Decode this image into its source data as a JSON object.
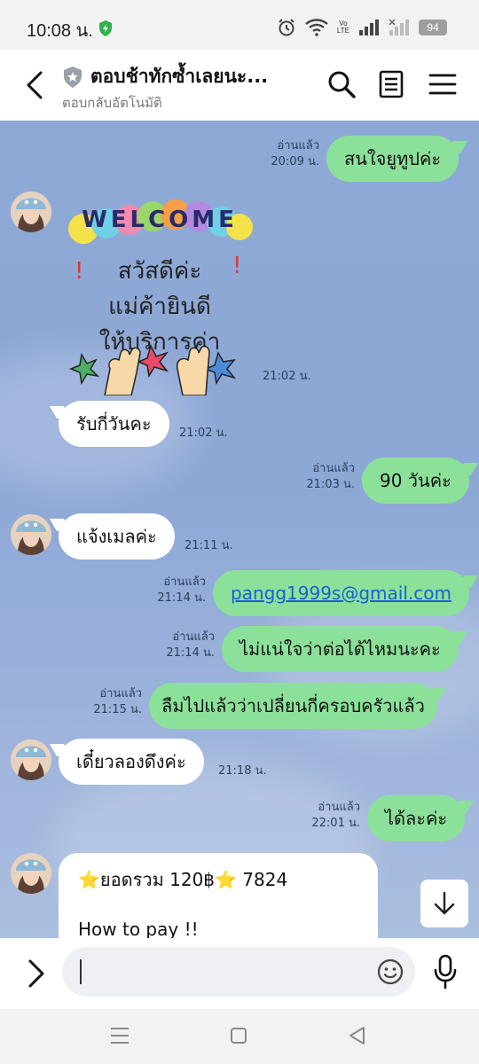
{
  "status_bar": {
    "time": "10:08 น.",
    "battery": "94",
    "volte_top": "Vo",
    "volte_bottom": "LTE"
  },
  "header": {
    "title": "ตอบช้าทักซ้ำเลยนะ...",
    "subtitle": "ตอบกลับอัตโนมัติ"
  },
  "messages": [
    {
      "id": "m1",
      "dir": "out",
      "text": "สนใจยูทูปค่ะ",
      "read": "อ่านแล้ว",
      "time": "20:09 น."
    },
    {
      "id": "m2",
      "dir": "in",
      "type": "sticker",
      "time": "21:02 น.",
      "sticker": {
        "welcome": "WELCOME",
        "line1": "สวัสดีค่ะ",
        "line2": "แม่ค้ายินดี",
        "line3": "ให้บริการค่า"
      }
    },
    {
      "id": "m3",
      "dir": "in",
      "text": "รับกี่วันคะ",
      "time": "21:02 น."
    },
    {
      "id": "m4",
      "dir": "out",
      "text": "90 วันค่ะ",
      "read": "อ่านแล้ว",
      "time": "21:03 น."
    },
    {
      "id": "m5",
      "dir": "in",
      "text": "แจ้งเมลค่ะ",
      "time": "21:11 น."
    },
    {
      "id": "m6",
      "dir": "out",
      "text": "pangg1999s@gmail.com",
      "read": "อ่านแล้ว",
      "time": "21:14 น."
    },
    {
      "id": "m7",
      "dir": "out",
      "text": "ไม่แน่ใจว่าต่อได้ไหมนะคะ",
      "read": "อ่านแล้ว",
      "time": "21:14 น."
    },
    {
      "id": "m8",
      "dir": "out",
      "text": "ลืมไปแล้วว่าเปลี่ยนกี่ครอบครัวแล้ว",
      "read": "อ่านแล้ว",
      "time": "21:15 น."
    },
    {
      "id": "m9",
      "dir": "in",
      "text": "เดี๋ยวลองดึงค่ะ",
      "time": "21:18 น."
    },
    {
      "id": "m10",
      "dir": "out",
      "text": "ได้ละค่ะ",
      "read": "อ่านแล้ว",
      "time": "22:01 น."
    },
    {
      "id": "m11",
      "dir": "in",
      "type": "card",
      "line1": "⭐ยอดรวม 120฿⭐ 7824",
      "line2": "How to pay !!"
    }
  ],
  "colors": {
    "outgoing_bubble": "#8ce19a",
    "incoming_bubble": "#ffffff",
    "chat_background": "#8fa9d6",
    "link": "#1a5fd6"
  },
  "icons": {
    "header": [
      "back-arrow-icon",
      "shield-badge-icon",
      "search-icon",
      "notes-icon",
      "menu-icon"
    ],
    "input": [
      "expand-arrow-icon",
      "emoji-icon",
      "microphone-icon"
    ],
    "nav": [
      "recent-apps-icon",
      "home-icon",
      "back-nav-icon"
    ]
  }
}
